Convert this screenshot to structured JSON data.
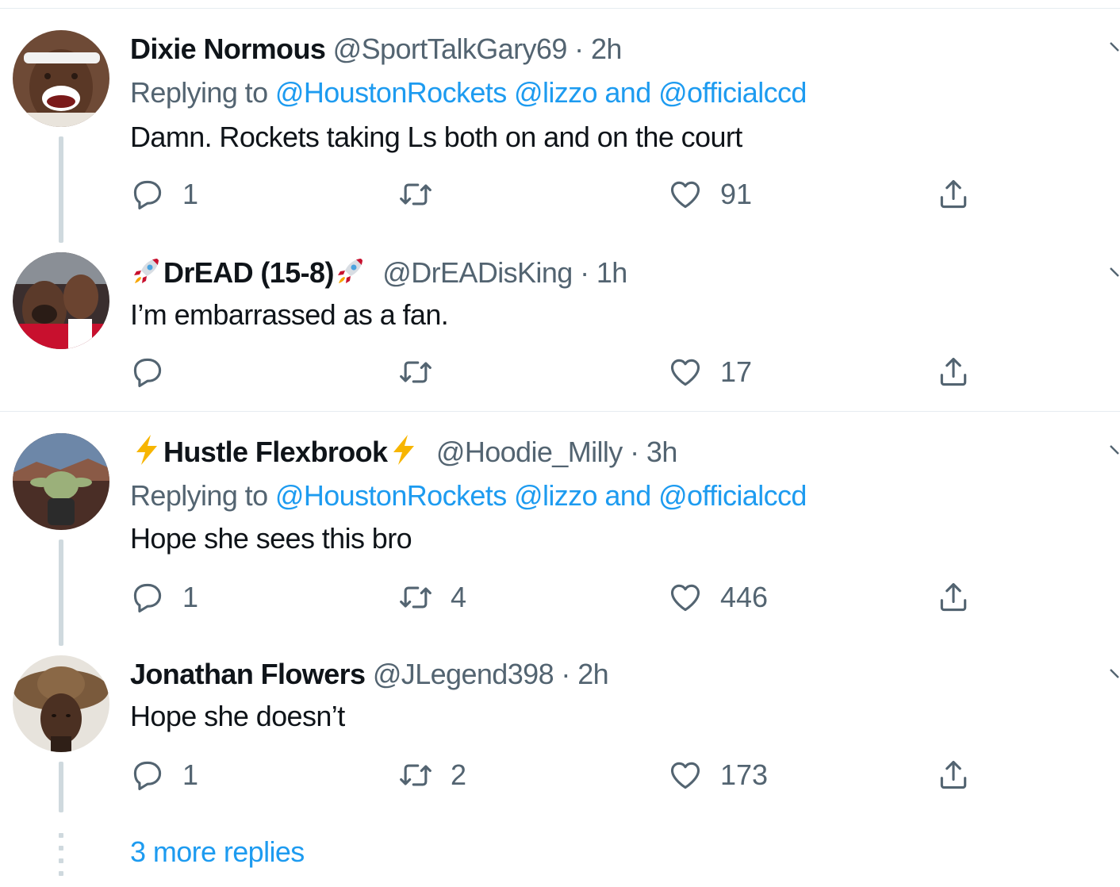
{
  "tweets": [
    {
      "name": "Dixie Normous",
      "handle": "@SportTalkGary69",
      "sep": "·",
      "time": "2h",
      "replying_prefix": "Replying to",
      "mention1": "@HoustonRockets",
      "mention2": "@lizzo",
      "and": "and",
      "mention3": "@officialccd",
      "text": "Damn. Rockets taking Ls both on and on the court",
      "replies": "1",
      "retweets": "",
      "likes": "91",
      "avatar": "person-white-headband"
    },
    {
      "name": "DrEAD (15-8)",
      "name_emoji": "rocket-icon",
      "handle": "@DrEADisKing",
      "sep": "·",
      "time": "1h",
      "text": "I’m embarrassed as a fan.",
      "replies": "",
      "retweets": "",
      "likes": "17",
      "avatar": "basketball-players"
    },
    {
      "name": "Hustle Flexbrook",
      "name_emoji": "lightning-icon",
      "handle": "@Hoodie_Milly",
      "sep": "·",
      "time": "3h",
      "replying_prefix": "Replying to",
      "mention1": "@HoustonRockets",
      "mention2": "@lizzo",
      "and": "and",
      "mention3": "@officialccd",
      "text": "Hope she sees this bro",
      "replies": "1",
      "retweets": "4",
      "likes": "446",
      "avatar": "baby-yoda-jersey"
    },
    {
      "name": "Jonathan Flowers",
      "handle": "@JLegend398",
      "sep": "·",
      "time": "2h",
      "text": "Hope she doesn’t",
      "replies": "1",
      "retweets": "2",
      "likes": "173",
      "avatar": "person-straw-hat"
    }
  ],
  "more_replies": "3 more replies",
  "colors": {
    "link": "#1d9bf0",
    "muted": "#536471",
    "text": "#0f1419",
    "divider": "#e6ecf0",
    "thread_line": "#cfd9de"
  }
}
